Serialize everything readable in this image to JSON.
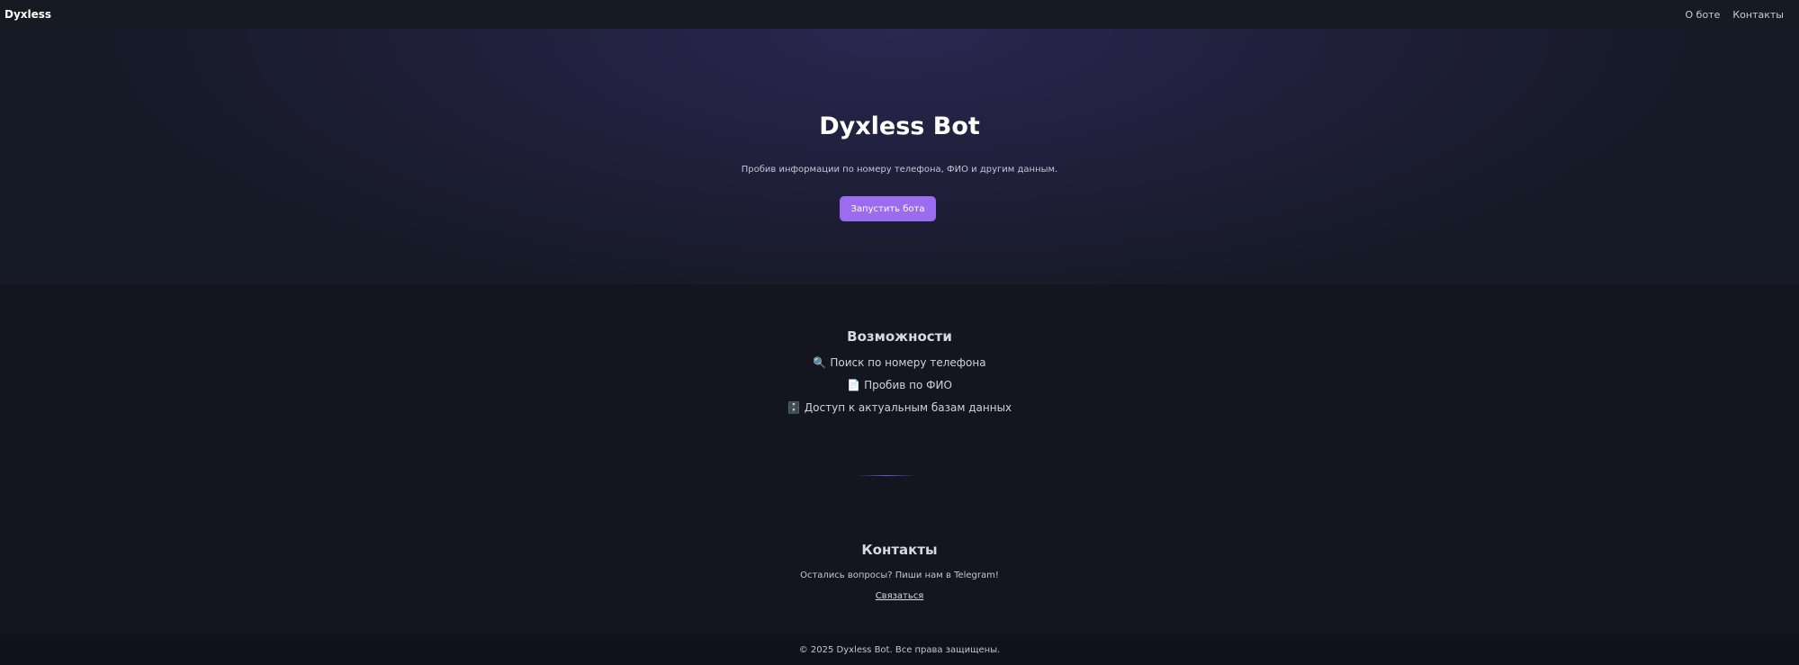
{
  "nav": {
    "brand": "Dyxless",
    "links": [
      "О боте",
      "Контакты"
    ]
  },
  "hero": {
    "title": "Dyxless Bot",
    "subtitle": "Пробив информации по номеру телефона, ФИО и другим данным.",
    "button_label": "Запустить бота"
  },
  "features": {
    "title": "Возможности",
    "items": [
      {
        "icon": "🔍",
        "icon_name": "magnifier-icon",
        "text": "Поиск по номеру телефона"
      },
      {
        "icon": "📄",
        "icon_name": "document-icon",
        "text": "Пробив по ФИО"
      },
      {
        "icon": "🗄️",
        "icon_name": "file-cabinet-icon",
        "text": "Доступ к актуальным базам данных"
      }
    ]
  },
  "contacts": {
    "title": "Контакты",
    "text": "Остались вопросы? Пиши нам в Telegram!",
    "link_label": "Связаться"
  },
  "footer": {
    "text": "© 2025 Dyxless Bot. Все права защищены."
  },
  "colors": {
    "accent": "#9b6cf0",
    "background": "#13161f",
    "navbar": "#161a23",
    "footer": "#0f121a"
  }
}
